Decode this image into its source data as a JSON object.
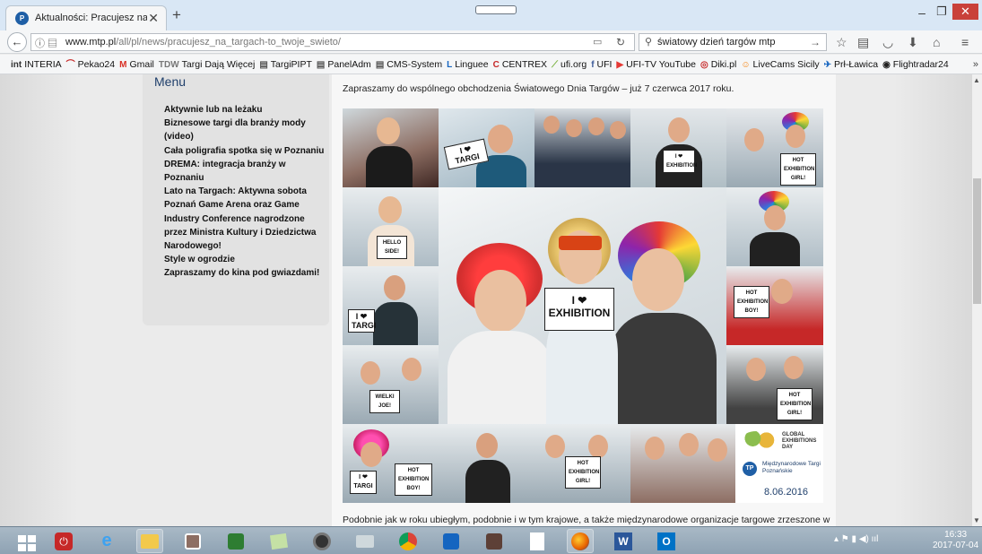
{
  "browser": {
    "tab_title": "Aktualności: Pracujesz na ta",
    "url_domain": "www.mtp.pl",
    "url_path": "/all/pl/news/pracujesz_na_targach-to_twoje_swieto/",
    "search_text": "światowy dzień targów mtp"
  },
  "bookmarks": [
    {
      "label": "INTERIA",
      "icon": "int"
    },
    {
      "label": "Pekao24",
      "icon": "pekao-icon"
    },
    {
      "label": "Gmail",
      "icon": "M"
    },
    {
      "label": "Targi Dają Więcej",
      "icon": "TDW"
    },
    {
      "label": "TargiPIPT",
      "icon": "page-icon"
    },
    {
      "label": "PanelAdm",
      "icon": "page-icon"
    },
    {
      "label": "CMS-System",
      "icon": "page-icon"
    },
    {
      "label": "Linguee",
      "icon": "L"
    },
    {
      "label": "CENTREX",
      "icon": "C"
    },
    {
      "label": "ufi.org",
      "icon": "ufi-icon"
    },
    {
      "label": "UFI",
      "icon": "f"
    },
    {
      "label": "UFI-TV YouTube",
      "icon": "youtube-icon"
    },
    {
      "label": "Diki.pl",
      "icon": "diki-icon"
    },
    {
      "label": "LiveCams Sicily",
      "icon": "livecams-icon"
    },
    {
      "label": "Prł-Ławica",
      "icon": "plane-icon"
    },
    {
      "label": "Flightradar24",
      "icon": "radar-icon"
    }
  ],
  "sidebar": {
    "title": "Menu",
    "items": [
      "Aktywnie lub na leżaku",
      "Biznesowe targi dla branży mody (video)",
      "Cała poligrafia spotka się w Poznaniu",
      "DREMA: integracja branży w Poznaniu",
      "Lato na Targach: Aktywna sobota",
      "Poznań Game Arena oraz Game Industry Conference nagrodzone przez Ministra Kultury i Dziedzictwa Narodowego!",
      "Style w ogrodzie",
      "Zapraszamy do kina pod gwiazdami!"
    ]
  },
  "article": {
    "intro": "Zapraszamy do wspólnego obchodzenia Światowego Dnia Targów – już 7 czerwca 2017 roku.",
    "outro": "Podobnie jak w roku ubiegłym, podobnie i w tym krajowe, a także międzynarodowe organizacje targowe zrzeszone w",
    "collage": {
      "signs": {
        "i_love_targi": "I ❤ TARGI",
        "i_love_exhibition": "I ❤ EXHIBITION",
        "hello_side": "HELLO SIDE!",
        "hot_exhibition_boy": "HOT EXHIBITION BOY!",
        "hot_exhibition_girl": "HOT EXHIBITION GIRL!",
        "wielki_joe": "WIELKI JOE!"
      },
      "caption_logo_text": "GLOBAL EXHIBITIONS DAY",
      "organizer": "Międzynarodowe Targi Poznańskie",
      "date": "8.06.2016"
    }
  },
  "system": {
    "time": "16:33",
    "date": "2017-07-04"
  }
}
